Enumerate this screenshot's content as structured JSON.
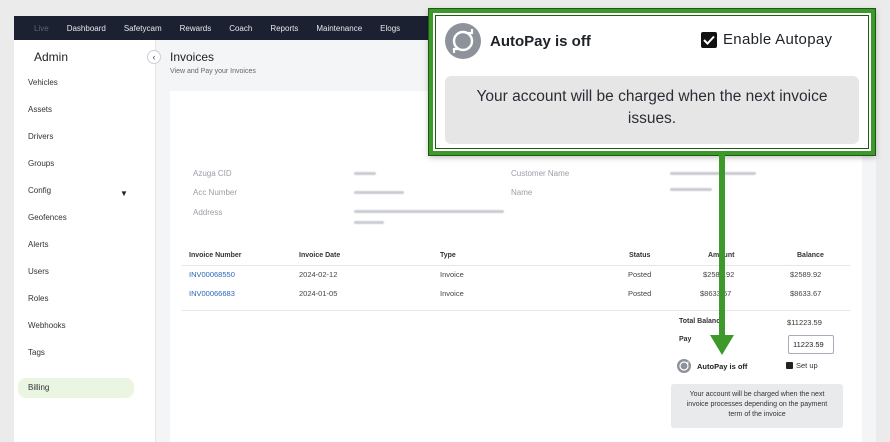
{
  "topnav": {
    "items": [
      "Live",
      "Dashboard",
      "Safetycam",
      "Rewards",
      "Coach",
      "Reports",
      "Maintenance",
      "Elogs"
    ]
  },
  "sidebar": {
    "title": "Admin",
    "items": [
      {
        "label": "Vehicles"
      },
      {
        "label": "Assets"
      },
      {
        "label": "Drivers"
      },
      {
        "label": "Groups"
      },
      {
        "label": "Config",
        "has_dropdown": true
      },
      {
        "label": "Geofences"
      },
      {
        "label": "Alerts"
      },
      {
        "label": "Users"
      },
      {
        "label": "Roles"
      },
      {
        "label": "Webhooks"
      },
      {
        "label": "Tags"
      },
      {
        "label": "Billing",
        "active": true
      }
    ]
  },
  "page": {
    "title": "Invoices",
    "subtitle": "View and Pay your Invoices"
  },
  "account_info": {
    "cid_label": "Azuga CID",
    "acc_label": "Acc Number",
    "address_label": "Address",
    "customer_name_label": "Customer Name",
    "name_label": "Name"
  },
  "table": {
    "headers": [
      "Invoice Number",
      "Invoice Date",
      "Type",
      "Status",
      "Amount",
      "Balance"
    ],
    "rows": [
      {
        "number": "INV00068550",
        "date": "2024-02-12",
        "type": "Invoice",
        "status": "Posted",
        "amount": "$2589.92",
        "balance": "$2589.92"
      },
      {
        "number": "INV00066683",
        "date": "2024-01-05",
        "type": "Invoice",
        "status": "Posted",
        "amount": "$8633.67",
        "balance": "$8633.67"
      }
    ]
  },
  "summary": {
    "total_label": "Total Balance",
    "total_value": "$11223.59",
    "pay_label": "Pay",
    "pay_value": "11223.59",
    "autopay_status": "AutoPay is off",
    "setup_label": "Set up",
    "note": "Your account will be charged when the next invoice processes depending on the payment term of the invoice"
  },
  "callout": {
    "autopay_status": "AutoPay is off",
    "enable_label": "Enable Autopay",
    "enable_checked": true,
    "note": "Your account will be charged when the next invoice issues.",
    "accent_color": "#3d9a2a"
  }
}
